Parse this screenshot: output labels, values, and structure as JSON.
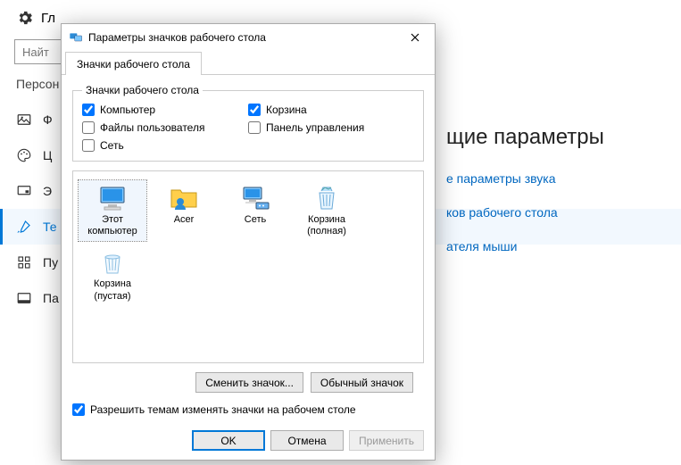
{
  "bg": {
    "head_title": "Гл",
    "search_placeholder": "Найт",
    "category": "Персон",
    "nav": [
      {
        "label": "Ф"
      },
      {
        "label": "Ц"
      },
      {
        "label": "Э"
      },
      {
        "label": "Те"
      },
      {
        "label": "Пу"
      },
      {
        "label": "Па"
      }
    ],
    "active_index": 3
  },
  "right": {
    "title": "щие параметры",
    "links": [
      "е параметры звука",
      "ков рабочего стола",
      "ателя мыши"
    ]
  },
  "dialog": {
    "title": "Параметры значков рабочего стола",
    "tab": "Значки рабочего стола",
    "group_legend": "Значки рабочего стола",
    "checkboxes": {
      "computer": {
        "label": "Компьютер",
        "checked": true
      },
      "recycle": {
        "label": "Корзина",
        "checked": true
      },
      "userfiles": {
        "label": "Файлы пользователя",
        "checked": false
      },
      "cpanel": {
        "label": "Панель управления",
        "checked": false
      },
      "network": {
        "label": "Сеть",
        "checked": false
      }
    },
    "icons": [
      {
        "name": "Этот компьютер",
        "kind": "pc"
      },
      {
        "name": "Acer",
        "kind": "folder"
      },
      {
        "name": "Сеть",
        "kind": "net"
      },
      {
        "name": "Корзина (полная)",
        "kind": "bin-full"
      },
      {
        "name": "Корзина (пустая)",
        "kind": "bin-empty"
      }
    ],
    "selected_icon": 0,
    "change_btn": "Сменить значок...",
    "default_btn": "Обычный значок",
    "allow_themes": {
      "label": "Разрешить темам изменять значки на рабочем столе",
      "checked": true
    },
    "ok": "OK",
    "cancel": "Отмена",
    "apply": "Применить"
  }
}
